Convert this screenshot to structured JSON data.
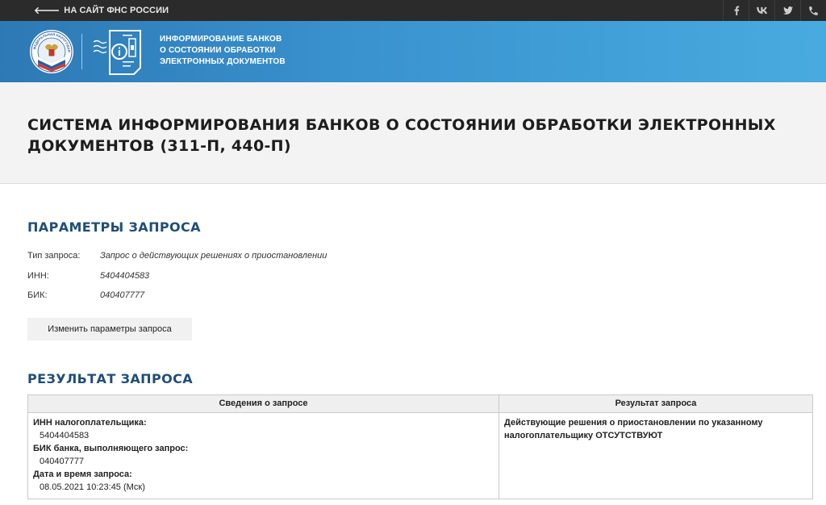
{
  "topbar": {
    "back_link": "НА САЙТ ФНС РОССИИ",
    "social_icons": [
      "facebook-icon",
      "vk-icon",
      "twitter-icon",
      "phone-icon"
    ]
  },
  "banner": {
    "lines": [
      "ИНФОРМИРОВАНИЕ БАНКОВ",
      "О СОСТОЯНИИ ОБРАБОТКИ",
      "ЭЛЕКТРОННЫХ ДОКУМЕНТОВ"
    ],
    "emblem_text": "ФЕДЕРАЛЬНАЯ НАЛОГОВАЯ СЛУЖБА"
  },
  "page": {
    "title": "СИСТЕМА ИНФОРМИРОВАНИЯ БАНКОВ О СОСТОЯНИИ ОБРАБОТКИ ЭЛЕКТРОННЫХ ДОКУМЕНТОВ (311-П, 440-П)"
  },
  "params": {
    "heading": "ПАРАМЕТРЫ ЗАПРОСА",
    "rows": [
      {
        "label": "Тип запроса:",
        "value": "Запрос о действующих решениях о приостановлении"
      },
      {
        "label": "ИНН:",
        "value": "5404404583"
      },
      {
        "label": "БИК:",
        "value": "040407777"
      }
    ],
    "change_button": "Изменить параметры запроса"
  },
  "result": {
    "heading": "РЕЗУЛЬТАТ ЗАПРОСА",
    "columns": [
      "Сведения о запросе",
      "Результат запроса"
    ],
    "info": {
      "inn_label": "ИНН налогоплательщика:",
      "inn_value": "5404404583",
      "bik_label": "БИК банка, выполняющего запрос:",
      "bik_value": "040407777",
      "datetime_label": "Дата и время запроса:",
      "datetime_value": "08.05.2021 10:23:45 (Мск)"
    },
    "answer": "Действующие решения о приостановлении по указанному налогоплательщику ОТСУТСТВУЮТ"
  },
  "colors": {
    "topbar_bg": "#2b2b2b",
    "banner_start": "#2d79b5",
    "banner_end": "#48abdf",
    "section_heading": "#1f4e79",
    "title_bg": "#f3f3f3"
  }
}
